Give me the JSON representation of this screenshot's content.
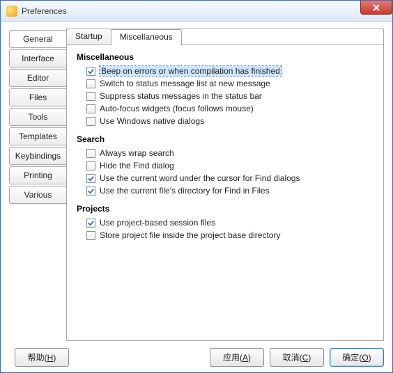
{
  "window": {
    "title": "Preferences"
  },
  "sidebar": {
    "items": [
      {
        "label": "General",
        "active": true
      },
      {
        "label": "Interface"
      },
      {
        "label": "Editor"
      },
      {
        "label": "Files"
      },
      {
        "label": "Tools"
      },
      {
        "label": "Templates"
      },
      {
        "label": "Keybindings"
      },
      {
        "label": "Printing"
      },
      {
        "label": "Various"
      }
    ]
  },
  "top_tabs": [
    {
      "label": "Startup"
    },
    {
      "label": "Miscellaneous",
      "active": true
    }
  ],
  "sections": {
    "misc": {
      "title": "Miscellaneous",
      "items": [
        {
          "label": "Beep on errors or when compilation has finished",
          "checked": true,
          "highlight": true
        },
        {
          "label": "Switch to status message list at new message",
          "checked": false
        },
        {
          "label": "Suppress status messages in the status bar",
          "checked": false
        },
        {
          "label": "Auto-focus widgets (focus follows mouse)",
          "checked": false
        },
        {
          "label": "Use Windows native dialogs",
          "checked": false
        }
      ]
    },
    "search": {
      "title": "Search",
      "items": [
        {
          "label": "Always wrap search",
          "checked": false
        },
        {
          "label": "Hide the Find dialog",
          "checked": false
        },
        {
          "label": "Use the current word under the cursor for Find dialogs",
          "checked": true
        },
        {
          "label": "Use the current file's directory for Find in Files",
          "checked": true
        }
      ]
    },
    "projects": {
      "title": "Projects",
      "items": [
        {
          "label": "Use project-based session files",
          "checked": true
        },
        {
          "label": "Store project file inside the project base directory",
          "checked": false
        }
      ]
    }
  },
  "buttons": {
    "help": {
      "text": "帮助(",
      "key": "H",
      "suffix": ")"
    },
    "apply": {
      "text": "应用(",
      "key": "A",
      "suffix": ")"
    },
    "cancel": {
      "text": "取消(",
      "key": "C",
      "suffix": ")"
    },
    "ok": {
      "text": "确定(",
      "key": "O",
      "suffix": ")"
    }
  }
}
